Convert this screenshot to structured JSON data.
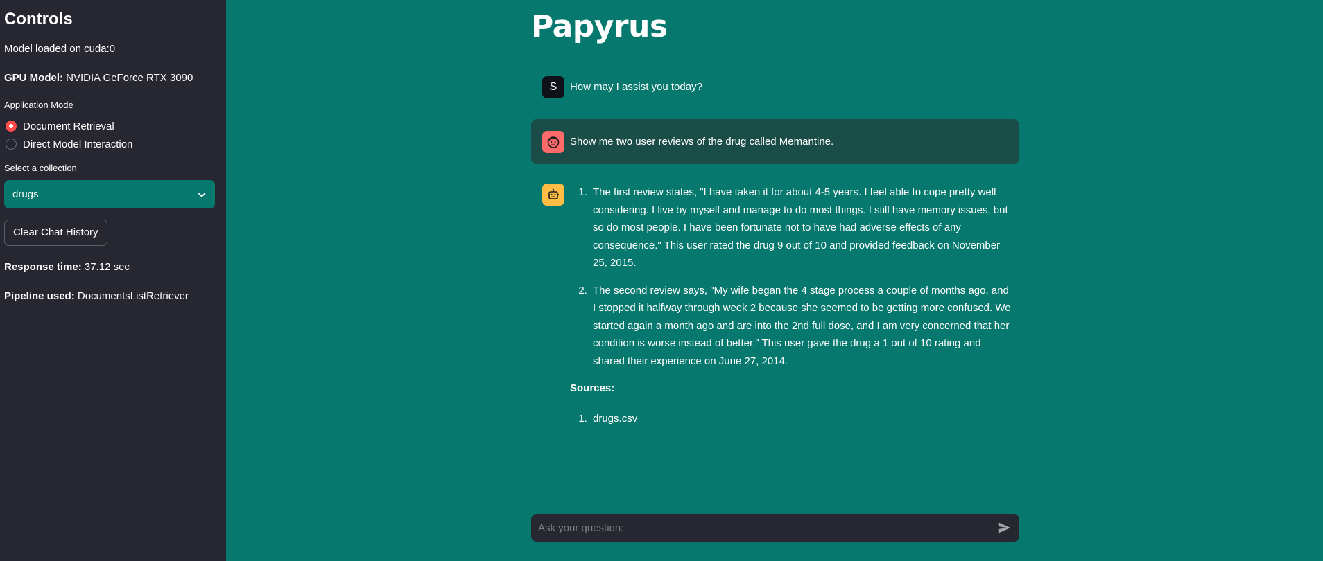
{
  "sidebar": {
    "title": "Controls",
    "model_loaded": "Model loaded on cuda:0",
    "gpu_label": "GPU Model:",
    "gpu_value": "NVIDIA GeForce RTX 3090",
    "mode_label": "Application Mode",
    "modes": [
      {
        "label": "Document Retrieval",
        "selected": true
      },
      {
        "label": "Direct Model Interaction",
        "selected": false
      }
    ],
    "collection_label": "Select a collection",
    "collection_value": "drugs",
    "clear_button": "Clear Chat History",
    "response_label": "Response time:",
    "response_value": "37.12 sec",
    "pipeline_label": "Pipeline used:",
    "pipeline_value": "DocumentsListRetriever"
  },
  "main": {
    "title": "Papyrus",
    "messages": [
      {
        "avatar": "S",
        "role": "system",
        "text": "How may I assist you today?"
      },
      {
        "avatar": "user-face-icon",
        "role": "user",
        "text": "Show me two user reviews of the drug called Memantine."
      },
      {
        "avatar": "robot-icon",
        "role": "assistant",
        "answers": [
          "The first review states, \"I have taken it for about 4-5 years. I feel able to cope pretty well considering. I live by myself and manage to do most things. I still have memory issues, but so do most people. I have been fortunate not to have had adverse effects of any consequence.\" This user rated the drug 9 out of 10 and provided feedback on November 25, 2015.",
          "The second review says, \"My wife began the 4 stage process a couple of months ago, and I stopped it halfway through week 2 because she seemed to be getting more confused. We started again a month ago and are into the 2nd full dose, and I am very concerned that her condition is worse instead of better.\" This user gave the drug a 1 out of 10 rating and shared their experience on June 27, 2014."
        ],
        "sources_label": "Sources:",
        "sources": [
          "drugs.csv"
        ]
      }
    ]
  },
  "input": {
    "placeholder": "Ask your question:"
  },
  "colors": {
    "background": "#06786d",
    "sidebar": "#262730",
    "accent": "#ff4b4b"
  }
}
